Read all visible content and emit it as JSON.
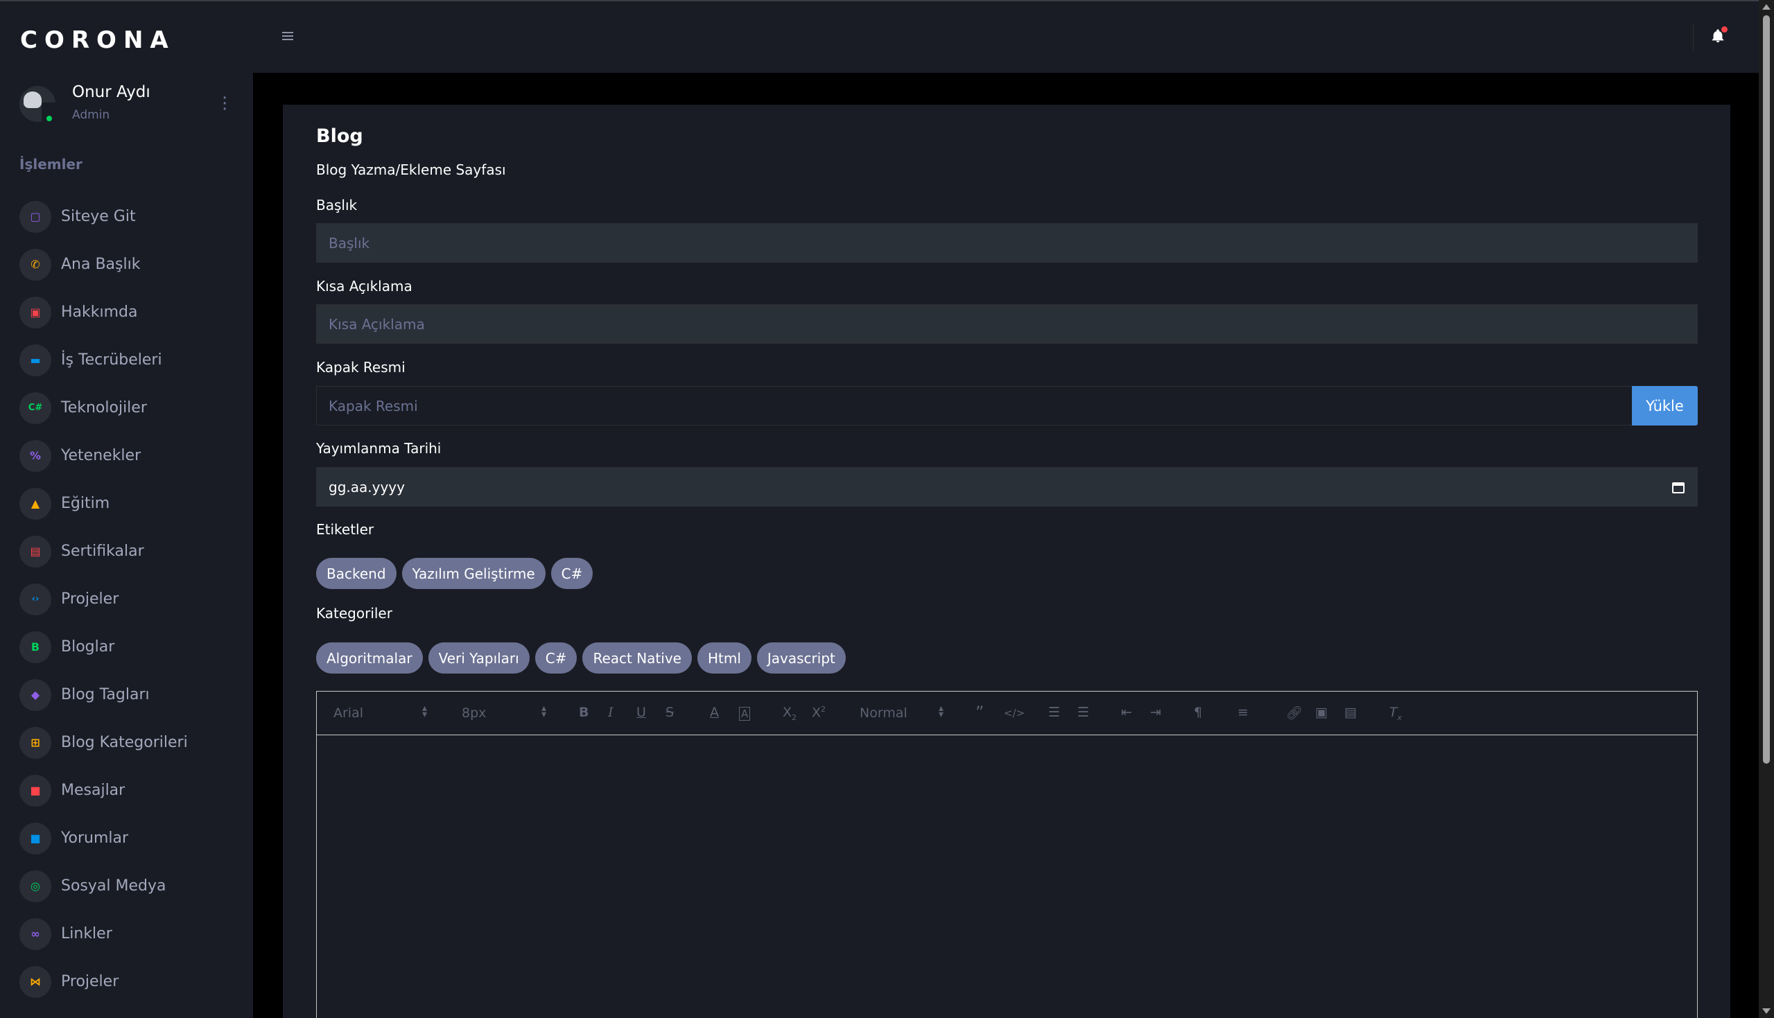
{
  "brand": "CORONA",
  "profile": {
    "name": "Onur Aydı",
    "role": "Admin"
  },
  "sidebar": {
    "section_label": "İşlemler",
    "items": [
      {
        "label": "Siteye Git",
        "icon": "window-icon",
        "color": "#8f5fe8"
      },
      {
        "label": "Ana Başlık",
        "icon": "phone-icon",
        "color": "#ffab00"
      },
      {
        "label": "Hakkımda",
        "icon": "robot-icon",
        "color": "#fc424a"
      },
      {
        "label": "İş Tecrübeleri",
        "icon": "briefcase-icon",
        "color": "#0090e7"
      },
      {
        "label": "Teknolojiler",
        "icon": "csharp-icon",
        "color": "#00d25b"
      },
      {
        "label": "Yetenekler",
        "icon": "percent-icon",
        "color": "#8f5fe8"
      },
      {
        "label": "Eğitim",
        "icon": "graduation-cap-icon",
        "color": "#ffab00"
      },
      {
        "label": "Sertifikalar",
        "icon": "certificate-icon",
        "color": "#fc424a"
      },
      {
        "label": "Projeler",
        "icon": "code-icon",
        "color": "#0090e7"
      },
      {
        "label": "Bloglar",
        "icon": "blog-icon",
        "color": "#00d25b"
      },
      {
        "label": "Blog Tagları",
        "icon": "tag-icon",
        "color": "#8f5fe8"
      },
      {
        "label": "Blog Kategorileri",
        "icon": "categories-icon",
        "color": "#ffab00"
      },
      {
        "label": "Mesajlar",
        "icon": "message-icon",
        "color": "#fc424a"
      },
      {
        "label": "Yorumlar",
        "icon": "comment-icon",
        "color": "#0090e7"
      },
      {
        "label": "Sosyal Medya",
        "icon": "instagram-icon",
        "color": "#00d25b"
      },
      {
        "label": "Linkler",
        "icon": "link-icon",
        "color": "#8f5fe8"
      },
      {
        "label": "Projeler",
        "icon": "vscode-icon",
        "color": "#ffab00"
      }
    ]
  },
  "page": {
    "title": "Blog",
    "description": "Blog Yazma/Ekleme Sayfası",
    "fields": {
      "title": {
        "label": "Başlık",
        "placeholder": "Başlık"
      },
      "summary": {
        "label": "Kısa Açıklama",
        "placeholder": "Kısa Açıklama"
      },
      "cover": {
        "label": "Kapak Resmi",
        "placeholder": "Kapak Resmi",
        "button": "Yükle"
      },
      "date": {
        "label": "Yayımlanma Tarihi",
        "value": "gg.aa.yyyy"
      },
      "tags": {
        "label": "Etiketler",
        "items": [
          "Backend",
          "Yazılım Geliştirme",
          "C#"
        ]
      },
      "categories": {
        "label": "Kategoriler",
        "items": [
          "Algoritmalar",
          "Veri Yapıları",
          "C#",
          "React Native",
          "Html",
          "Javascript"
        ]
      }
    },
    "editor": {
      "font": "Arial",
      "size": "8px",
      "heading": "Normal"
    }
  },
  "colors": {
    "accent": "#4790e0",
    "sidebar_bg": "#191c24",
    "chip_bg": "#6c7293",
    "notification": "#fc424a"
  }
}
